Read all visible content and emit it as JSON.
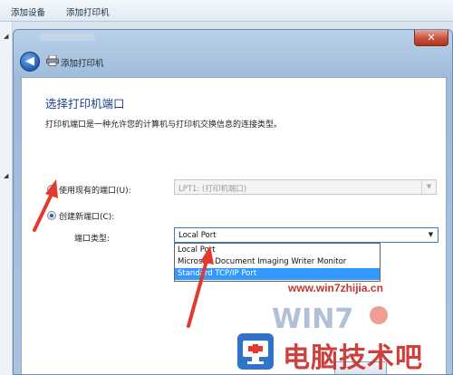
{
  "explorer": {
    "add_device": "添加设备",
    "add_printer": "添加打印机"
  },
  "dialog": {
    "nav_title": "添加打印机",
    "close_symbol": "✕",
    "back_symbol": "◀"
  },
  "page": {
    "heading": "选择打印机端口",
    "description": "打印机端口是一种允许您的计算机与打印机交换信息的连接类型。"
  },
  "options": {
    "existing_label": "使用现有的端口(U):",
    "existing_value": "LPT1: (打印机端口)",
    "new_label": "创建新端口(C):",
    "port_type_label": "端口类型:",
    "port_type_value": "Local Port",
    "port_type_options": [
      "Local Port",
      "Microsoft Document Imaging Writer Monitor",
      "Standard TCP/IP Port"
    ],
    "selected_option_index": 2,
    "existing_checked": false,
    "new_checked": true
  },
  "watermark": {
    "url": "www.win7zhijia.cn",
    "brand": "电脑技术吧"
  },
  "colors": {
    "accent_blue": "#3399ff",
    "heading_blue": "#1f3f8f",
    "arrow_red": "#e23b2e"
  }
}
